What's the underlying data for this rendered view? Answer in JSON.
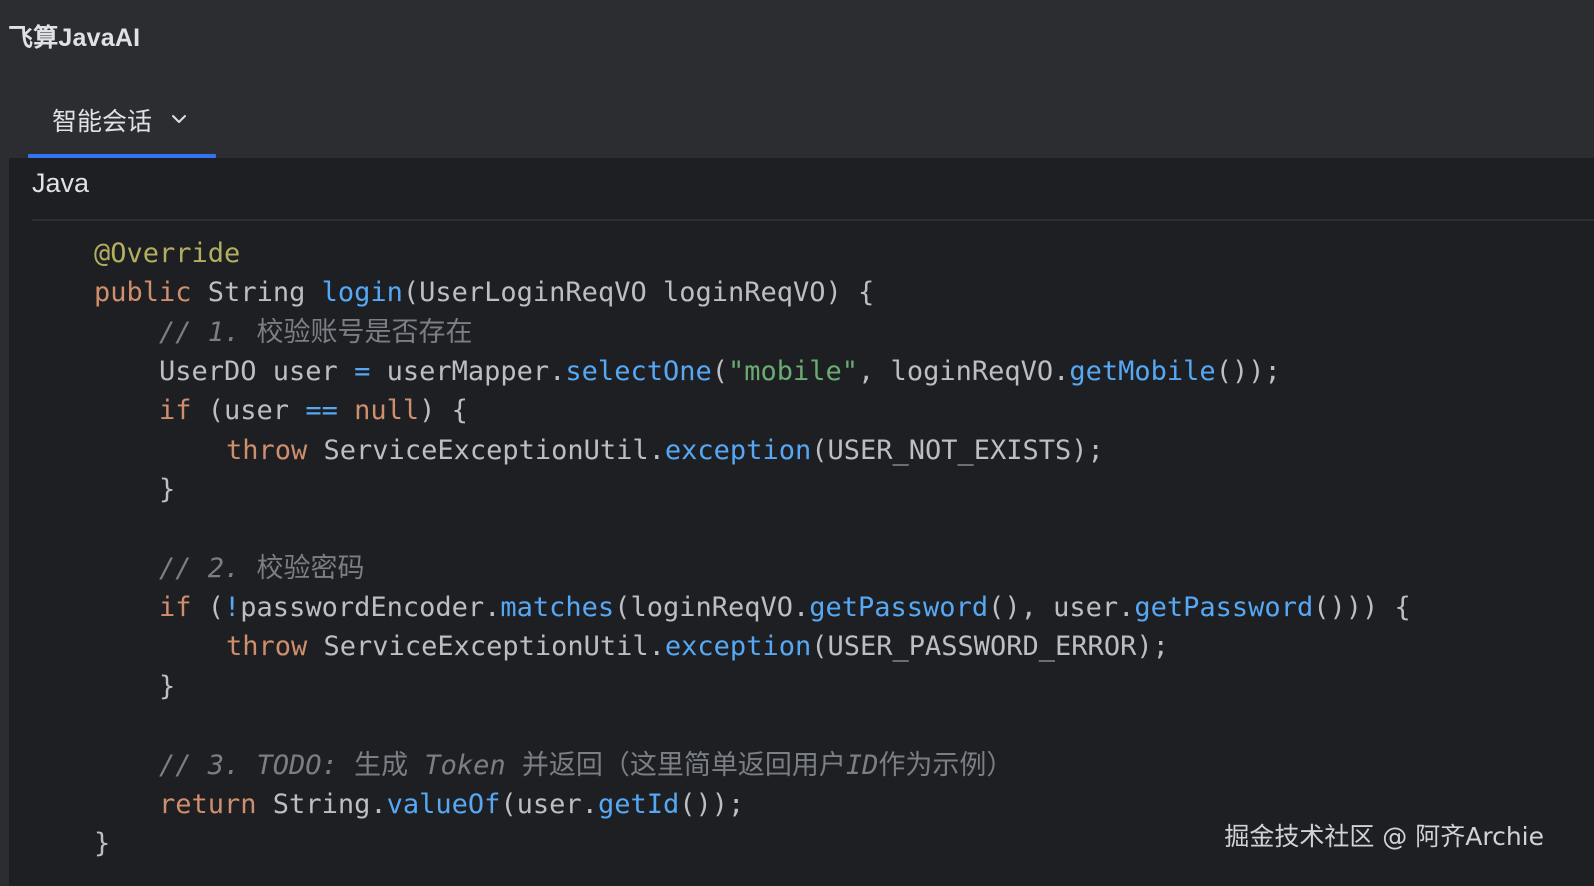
{
  "app": {
    "title": "飞算JavaAI"
  },
  "tabs": [
    {
      "label": "智能会话",
      "active": true
    }
  ],
  "code_block": {
    "language": "Java",
    "lines": {
      "l1": {
        "t1": "@Override"
      },
      "l2": {
        "t1": "public",
        "t2": " String ",
        "t3": "login",
        "t4": "(UserLoginReqVO loginReqVO) {"
      },
      "l3": {
        "t1": "// 1. ",
        "t2": "校验账号是否存在"
      },
      "l4": {
        "t1": "UserDO user ",
        "t2": "=",
        "t3": " userMapper.",
        "t4": "selectOne",
        "t5": "(",
        "t6": "\"mobile\"",
        "t7": ", loginReqVO.",
        "t8": "getMobile",
        "t9": "());"
      },
      "l5": {
        "t1": "if",
        "t2": " (user ",
        "t3": "==",
        "t4": " ",
        "t5": "null",
        "t6": ") {"
      },
      "l6": {
        "t1": "throw",
        "t2": " ServiceExceptionUtil.",
        "t3": "exception",
        "t4": "(USER_NOT_EXISTS);"
      },
      "l7": {
        "t1": "}"
      },
      "l8": {
        "t1": "// 2. ",
        "t2": "校验密码"
      },
      "l9": {
        "t1": "if",
        "t2": " (",
        "t3": "!",
        "t4": "passwordEncoder.",
        "t5": "matches",
        "t6": "(loginReqVO.",
        "t7": "getPassword",
        "t8": "(), user.",
        "t9": "getPassword",
        "t10": "())) {"
      },
      "l10": {
        "t1": "throw",
        "t2": " ServiceExceptionUtil.",
        "t3": "exception",
        "t4": "(USER_PASSWORD_ERROR);"
      },
      "l11": {
        "t1": "}"
      },
      "l12": {
        "t1": "// 3. TODO: ",
        "t2": "生成",
        "t3": " Token ",
        "t4": "并返回（这里简单返回用户",
        "t5": "ID",
        "t6": "作为示例）"
      },
      "l13": {
        "t1": "return",
        "t2": " String.",
        "t3": "valueOf",
        "t4": "(user.",
        "t5": "getId",
        "t6": "());"
      },
      "l14": {
        "t1": "}"
      }
    }
  },
  "watermark": {
    "text": "掘金技术社区 @ 阿齐Archie"
  },
  "colors": {
    "background": "#1e1f22",
    "toolbar": "#2b2d30",
    "accent": "#3574f0",
    "keyword": "#cf8e6d",
    "annotation": "#b3ae60",
    "method": "#56a8f5",
    "string": "#6aab73",
    "comment": "#7a7e85",
    "text": "#bcbec4"
  },
  "icons": {
    "tab_dropdown": "chevron-down-icon"
  }
}
